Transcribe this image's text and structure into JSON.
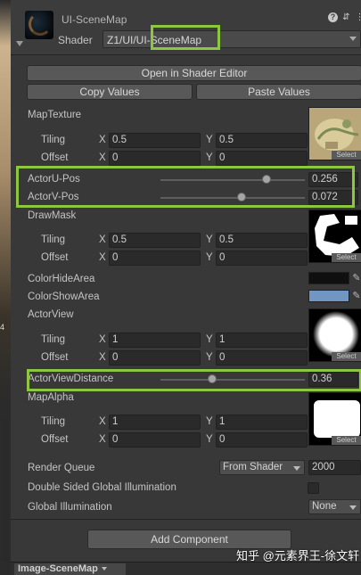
{
  "header": {
    "title": "UI-SceneMap",
    "shader_label": "Shader",
    "shader_value": "Z1/UI/UI-SceneMap"
  },
  "buttons": {
    "open_shader_editor": "Open in Shader Editor",
    "copy_values": "Copy Values",
    "paste_values": "Paste Values",
    "add_component": "Add Component"
  },
  "properties": {
    "map_texture": {
      "label": "MapTexture",
      "tiling_label": "Tiling",
      "offset_label": "Offset",
      "tiling_x": "0.5",
      "tiling_y": "0.5",
      "offset_x": "0",
      "offset_y": "0",
      "select": "Select"
    },
    "actor_u_pos": {
      "label": "ActorU-Pos",
      "value": "0.256",
      "level": 0.256
    },
    "actor_v_pos": {
      "label": "ActorV-Pos",
      "value": "0.072",
      "level": 0.072
    },
    "draw_mask": {
      "label": "DrawMask",
      "tiling_label": "Tiling",
      "offset_label": "Offset",
      "tiling_x": "0.5",
      "tiling_y": "0.5",
      "offset_x": "0",
      "offset_y": "0",
      "select": "Select"
    },
    "color_hide_area": {
      "label": "ColorHideArea",
      "color": "#101010"
    },
    "color_show_area": {
      "label": "ColorShowArea",
      "color": "#7296c4"
    },
    "actor_view": {
      "label": "ActorView",
      "tiling_label": "Tiling",
      "offset_label": "Offset",
      "tiling_x": "1",
      "tiling_y": "1",
      "offset_x": "0",
      "offset_y": "0",
      "select": "Select"
    },
    "actor_view_distance": {
      "label": "ActorViewDistance",
      "value": "0.36",
      "level": 0.36
    },
    "map_alpha": {
      "label": "MapAlpha",
      "tiling_label": "Tiling",
      "offset_label": "Offset",
      "tiling_x": "1",
      "tiling_y": "1",
      "offset_x": "0",
      "offset_y": "0",
      "select": "Select"
    }
  },
  "settings": {
    "render_queue_label": "Render Queue",
    "render_queue_mode": "From Shader",
    "render_queue_value": "2000",
    "double_sided_gi_label": "Double Sided Global Illumination",
    "global_illumination_label": "Global Illumination",
    "global_illumination_value": "None"
  },
  "axes": {
    "x": "X",
    "y": "Y"
  },
  "bottom": {
    "tab_label": "Image-SceneMap"
  },
  "watermark": "知乎 @元素界王-徐文轩",
  "colors": {
    "highlight": "#8dc63f",
    "panel_bg": "#383838"
  }
}
